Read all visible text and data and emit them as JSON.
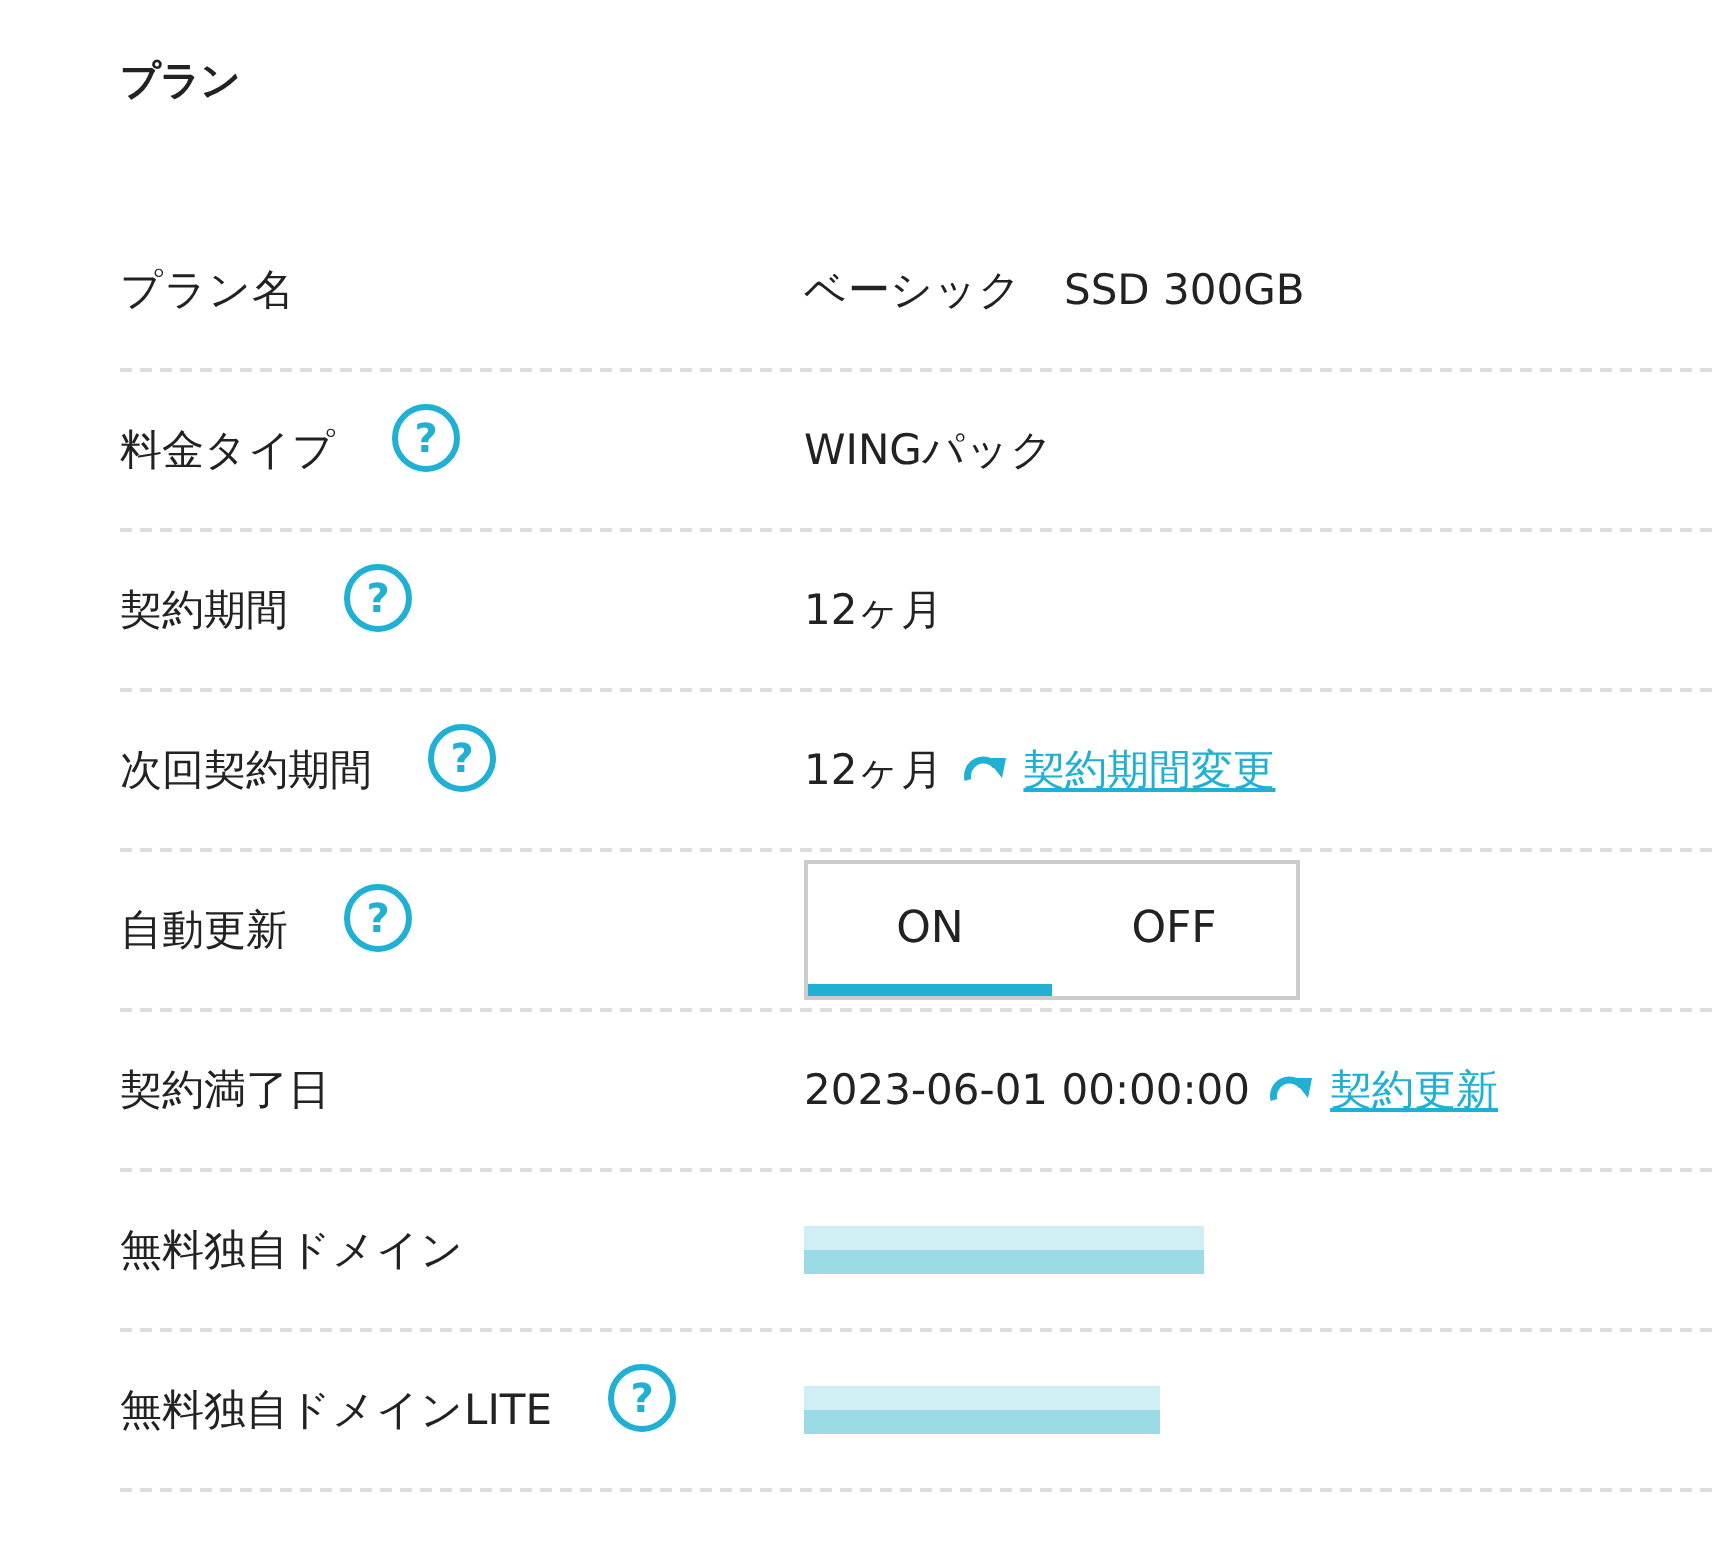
{
  "section_title": "プラン",
  "rows": [
    {
      "label": "プラン名",
      "kind": "text",
      "value": "ベーシック　SSD 300GB"
    },
    {
      "label": "料金タイプ",
      "help": "?",
      "kind": "text",
      "value": "WINGパック"
    },
    {
      "label": "契約期間",
      "help": "?",
      "kind": "text",
      "value": "12ヶ月"
    },
    {
      "label": "次回契約期間",
      "help": "?",
      "kind": "link",
      "value": "12ヶ月",
      "link": "契約期間変更"
    },
    {
      "label": "自動更新",
      "help": "?",
      "kind": "toggle",
      "options": [
        {
          "label": "ON",
          "selected": true
        },
        {
          "label": "OFF",
          "selected": false
        }
      ]
    },
    {
      "label": "契約満了日",
      "kind": "link",
      "value": "2023-06-01 00:00:00",
      "link": "契約更新"
    },
    {
      "label": "無料独自ドメイン",
      "kind": "redacted"
    },
    {
      "label": "無料独自ドメインLITE",
      "help": "?",
      "kind": "redacted"
    }
  ]
}
